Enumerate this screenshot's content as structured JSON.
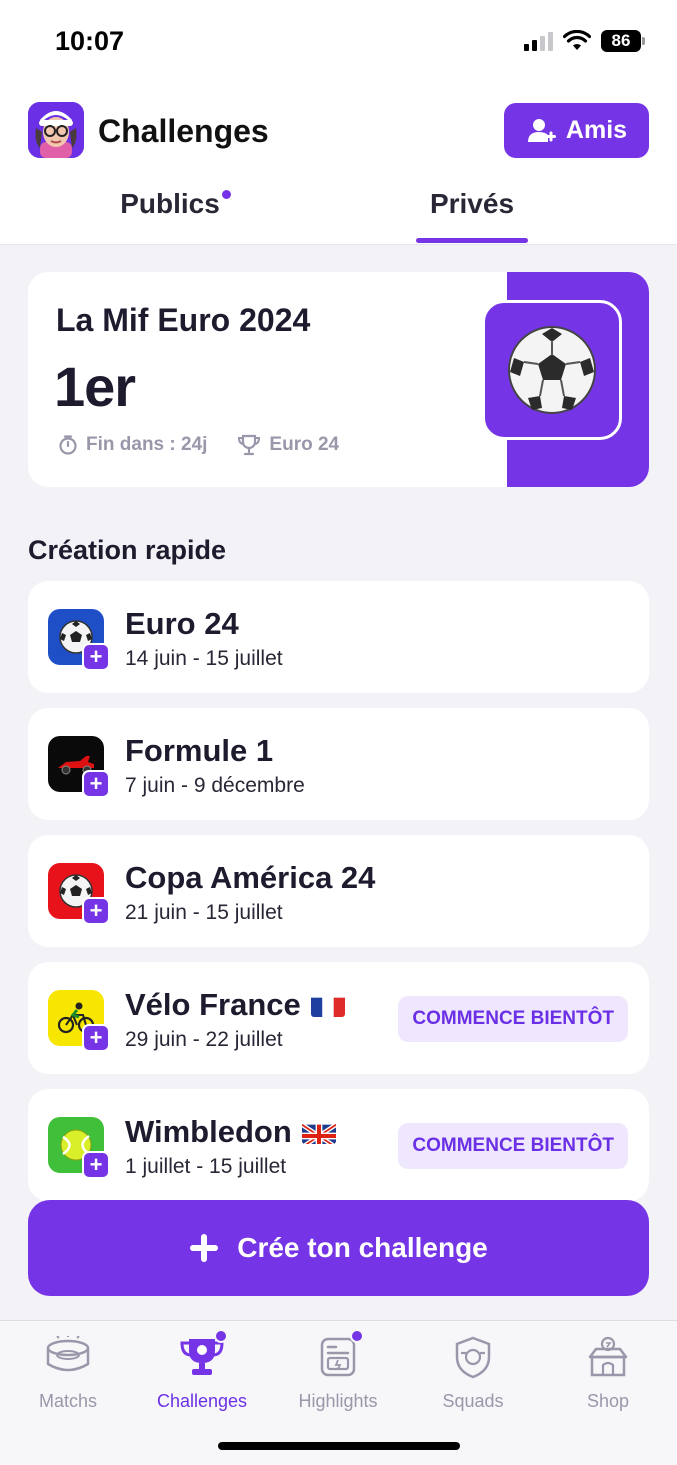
{
  "status_bar": {
    "time": "10:07",
    "battery": "86"
  },
  "header": {
    "title": "Challenges",
    "friends_label": "Amis"
  },
  "tabs": [
    {
      "label": "Publics",
      "has_dot": true
    },
    {
      "label": "Privés",
      "active": true
    }
  ],
  "featured": {
    "name": "La Mif Euro 2024",
    "rank": "1er",
    "ends_in": "Fin dans : 24j",
    "competition": "Euro 24",
    "icon": "soccer-ball-icon"
  },
  "quick_create": {
    "title": "Création rapide",
    "items": [
      {
        "title": "Euro 24",
        "dates": "14 juin - 15 juillet",
        "icon": "soccer-ball-icon",
        "icon_bg": "#1f4fc7"
      },
      {
        "title": "Formule 1",
        "dates": "7 juin - 9 décembre",
        "icon": "race-car-icon",
        "icon_bg": "#0a0a0a"
      },
      {
        "title": "Copa América 24",
        "dates": "21 juin - 15 juillet",
        "icon": "soccer-ball-icon",
        "icon_bg": "#e8121b"
      },
      {
        "title": "Vélo France",
        "dates": "29 juin - 22 juillet",
        "icon": "cyclist-icon",
        "icon_bg": "#f7e600",
        "flag": "france-flag-icon",
        "badge": "COMMENCE BIENTÔT"
      },
      {
        "title": "Wimbledon",
        "dates": "1 juillet - 15 juillet",
        "icon": "tennis-ball-icon",
        "icon_bg": "#3fbf3a",
        "flag": "uk-flag-icon",
        "badge": "COMMENCE BIENTÔT"
      }
    ]
  },
  "create_button": {
    "label": "Crée ton challenge"
  },
  "bottom_nav": [
    {
      "label": "Matchs",
      "icon": "stadium-icon"
    },
    {
      "label": "Challenges",
      "icon": "trophy-icon",
      "active": true,
      "has_dot": true
    },
    {
      "label": "Highlights",
      "icon": "highlights-icon",
      "has_dot": true
    },
    {
      "label": "Squads",
      "icon": "shield-icon"
    },
    {
      "label": "Shop",
      "icon": "shop-icon"
    }
  ],
  "colors": {
    "accent": "#7535e6",
    "background": "#f2f2f7",
    "badge_bg": "#efe7fd"
  }
}
